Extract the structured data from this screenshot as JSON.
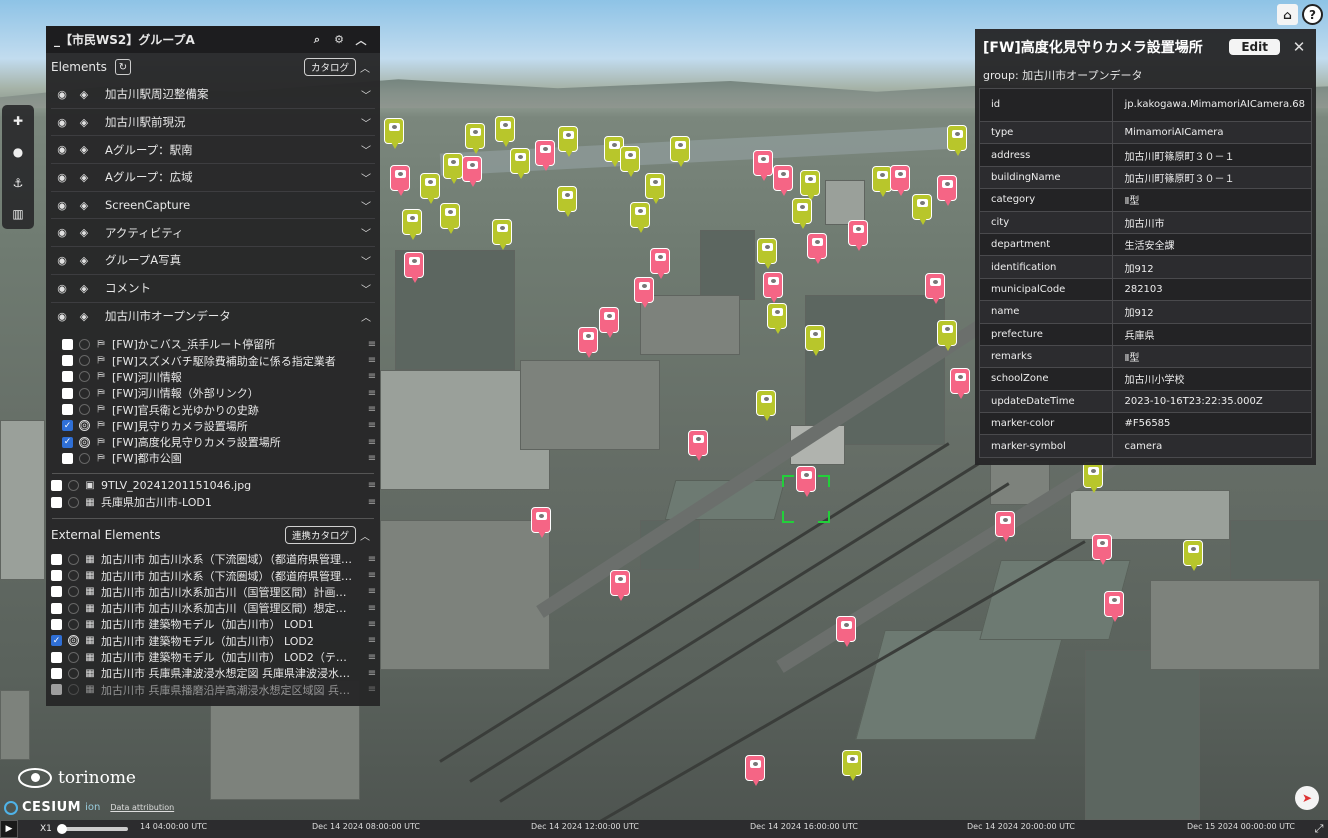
{
  "colors": {
    "marker_pink": "#F56585",
    "marker_green": "#B8C62B",
    "selection": "#22D03A",
    "panel_bg": "#262628",
    "checkbox_on": "#2F6FD6"
  },
  "left_panel": {
    "title": "_【市民WS2】グループA",
    "icons": [
      "search-icon",
      "gear-icon",
      "chevron-up-icon"
    ],
    "elements_label": "Elements",
    "catalog_button": "カタログ",
    "layers": [
      {
        "label": "加古川駅周辺整備案",
        "expanded": false
      },
      {
        "label": "加古川駅前現況",
        "expanded": false
      },
      {
        "label": "Aグループ：駅南",
        "expanded": false
      },
      {
        "label": "Aグループ：広域",
        "expanded": false
      },
      {
        "label": "ScreenCapture",
        "expanded": false
      },
      {
        "label": "アクティビティ",
        "expanded": false
      },
      {
        "label": "グループA写真",
        "expanded": false
      },
      {
        "label": "コメント",
        "expanded": false
      },
      {
        "label": "加古川市オープンデータ",
        "expanded": true
      }
    ],
    "opendata_items": [
      {
        "label": "[FW]かこバス_浜手ルート停留所",
        "checked": false,
        "active": false
      },
      {
        "label": "[FW]スズメバチ駆除費補助金に係る指定業者",
        "checked": false,
        "active": false
      },
      {
        "label": "[FW]河川情報",
        "checked": false,
        "active": false
      },
      {
        "label": "[FW]河川情報（外部リンク）",
        "checked": false,
        "active": false
      },
      {
        "label": "[FW]官兵衛と光ゆかりの史跡",
        "checked": false,
        "active": false
      },
      {
        "label": "[FW]見守りカメラ設置場所",
        "checked": true,
        "active": true
      },
      {
        "label": "[FW]高度化見守りカメラ設置場所",
        "checked": true,
        "active": true
      },
      {
        "label": "[FW]都市公園",
        "checked": false,
        "active": false
      }
    ],
    "loose_items": [
      {
        "label": "9TLV_20241201151046.jpg",
        "checked": false,
        "icon": "image-icon"
      },
      {
        "label": "兵庫県加古川市-LOD1",
        "checked": false,
        "icon": "building-icon"
      }
    ],
    "external_label": "External Elements",
    "external_catalog_button": "連携カタログ",
    "external_items": [
      {
        "label": "加古川市 加古川水系（下流圏域）（都道府県管理…",
        "checked": false
      },
      {
        "label": "加古川市 加古川水系（下流圏域）（都道府県管理…",
        "checked": false
      },
      {
        "label": "加古川市 加古川水系加古川（国管理区間）計画…",
        "checked": false
      },
      {
        "label": "加古川市 加古川水系加古川（国管理区間）想定…",
        "checked": false
      },
      {
        "label": "加古川市 建築物モデル（加古川市） LOD1",
        "checked": false
      },
      {
        "label": "加古川市 建築物モデル（加古川市） LOD2",
        "checked": true
      },
      {
        "label": "加古川市 建築物モデル（加古川市） LOD2（テ…",
        "checked": false
      },
      {
        "label": "加古川市 兵庫県津波浸水想定図 兵庫県津波浸水…",
        "checked": false
      },
      {
        "label": "加古川市 兵庫県播磨沿岸高潮浸水想定区域図 兵…",
        "checked": false
      }
    ]
  },
  "right_panel": {
    "title": "[FW]高度化見守りカメラ設置場所",
    "edit_label": "Edit",
    "close_icon": "close-icon",
    "group": "group: 加古川市オープンデータ",
    "properties": [
      {
        "key": "id",
        "value": "jp.kakogawa.MimamoriAICamera.68"
      },
      {
        "key": "type",
        "value": "MimamoriAICamera"
      },
      {
        "key": "address",
        "value": "加古川町篠原町３０－１"
      },
      {
        "key": "buildingName",
        "value": "加古川町篠原町３０－１"
      },
      {
        "key": "category",
        "value": "Ⅱ型"
      },
      {
        "key": "city",
        "value": "加古川市"
      },
      {
        "key": "department",
        "value": "生活安全課"
      },
      {
        "key": "identification",
        "value": "加912"
      },
      {
        "key": "municipalCode",
        "value": "282103"
      },
      {
        "key": "name",
        "value": "加912"
      },
      {
        "key": "prefecture",
        "value": "兵庫県"
      },
      {
        "key": "remarks",
        "value": "Ⅱ型"
      },
      {
        "key": "schoolZone",
        "value": "加古川小学校"
      },
      {
        "key": "updateDateTime",
        "value": "2023-10-16T23:22:35.000Z"
      },
      {
        "key": "marker-color",
        "value": "#F56585"
      },
      {
        "key": "marker-symbol",
        "value": "camera"
      }
    ]
  },
  "toolbar": {
    "icons": [
      "plus-icon",
      "comment-icon",
      "anchor-icon",
      "map-icon"
    ]
  },
  "top_buttons": {
    "icons": [
      "home-icon",
      "help-icon"
    ]
  },
  "branding": {
    "logo_text": "torinome",
    "cesium_text": "CESIUM",
    "cesium_ion": "ion",
    "attribution": "Data attribution"
  },
  "timeline": {
    "speed": "X1",
    "ticks": [
      "14 04:00:00 UTC",
      "Dec 14 2024 08:00:00 UTC",
      "Dec 14 2024 12:00:00 UTC",
      "Dec 14 2024 16:00:00 UTC",
      "Dec 14 2024 20:00:00 UTC",
      "Dec 15 2024 00:00:00 UTC"
    ]
  }
}
